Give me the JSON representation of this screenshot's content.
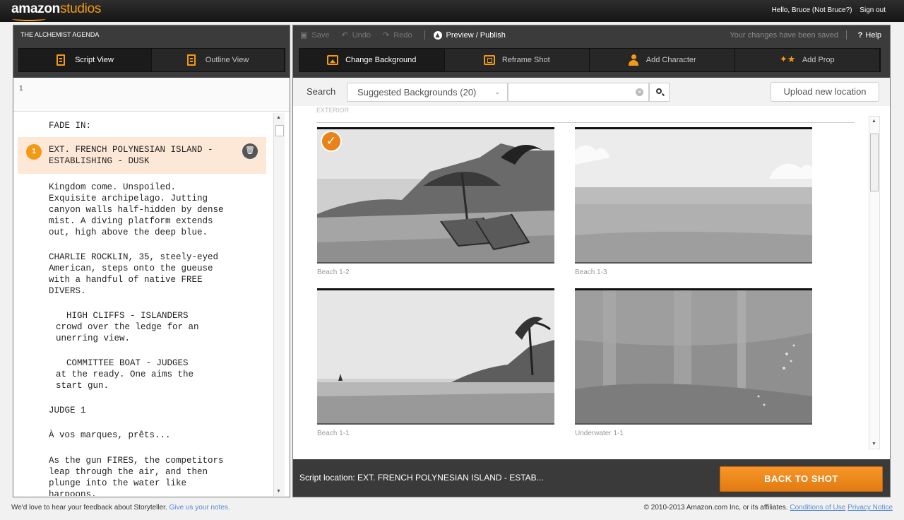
{
  "header": {
    "logo_part1": "amazon",
    "logo_part2": "studios",
    "greeting": "Hello, Bruce (Not Bruce?)",
    "sign_out": "Sign out"
  },
  "left": {
    "project_title": "THE ALCHEMIST AGENDA",
    "tabs": [
      {
        "label": "Script View",
        "icon": "document-icon",
        "active": true
      },
      {
        "label": "Outline View",
        "icon": "outline-icon",
        "active": false
      }
    ],
    "page_number": "1",
    "script": {
      "fade_in": "FADE IN:",
      "scene_number": "1",
      "scene_heading_line1": "EXT. FRENCH POLYNESIAN ISLAND -",
      "scene_heading_line2": "ESTABLISHING - DUSK",
      "action1": "Kingdom come. Unspoiled.\nExquisite archipelago. Jutting\ncanyon walls half-hidden by dense\nmist. A diving platform extends\nout, high above the deep blue.",
      "action2": "CHARLIE ROCKLIN, 35, steely-eyed\nAmerican, steps onto the gueuse\nwith a handful of native FREE\nDIVERS.",
      "shot1": "  HIGH CLIFFS - ISLANDERS\ncrowd over the ledge for an\nunerring view.",
      "shot2": "  COMMITTEE BOAT - JUDGES\nat the ready. One aims the\nstart gun.",
      "character": "JUDGE 1",
      "dialogue": "À vos marques, prêts...",
      "action3": "As the gun FIRES, the competitors\nleap through the air, and then\nplunge into the water like\nharpoons."
    }
  },
  "toolbar": {
    "save": "Save",
    "undo": "Undo",
    "redo": "Redo",
    "preview": "Preview / Publish",
    "status": "Your changes have been saved",
    "help": "Help"
  },
  "actions": [
    {
      "label": "Change Background",
      "icon": "landscape-icon",
      "active": true
    },
    {
      "label": "Reframe Shot",
      "icon": "reframe-icon",
      "active": false
    },
    {
      "label": "Add Character",
      "icon": "person-icon",
      "active": false
    },
    {
      "label": "Add Prop",
      "icon": "stars-icon",
      "active": false
    }
  ],
  "search": {
    "label": "Search",
    "dropdown_value": "Suggested Backgrounds (20)",
    "input_value": "",
    "upload_label": "Upload new location"
  },
  "grid": {
    "section_label": "EXTERIOR",
    "items": [
      {
        "caption": "Beach 1-2",
        "selected": true
      },
      {
        "caption": "Beach 1-3",
        "selected": false
      },
      {
        "caption": "Beach 1-1",
        "selected": false
      },
      {
        "caption": "Underwater 1-1",
        "selected": false
      }
    ]
  },
  "footer_bar": {
    "script_location": "Script location: EXT. FRENCH POLYNESIAN ISLAND - ESTAB...",
    "back_button": "BACK TO SHOT"
  },
  "footer": {
    "feedback_text": "We'd love to hear your feedback about Storyteller.",
    "feedback_link": "Give us your notes.",
    "copyright": "© 2010-2013 Amazon.com Inc, or its affiliates.",
    "conditions": "Conditions of Use",
    "privacy": "Privacy Notice"
  },
  "colors": {
    "accent": "#f39a14",
    "dark_header": "#3b3b3b",
    "selected_scene": "#fde8d8"
  }
}
